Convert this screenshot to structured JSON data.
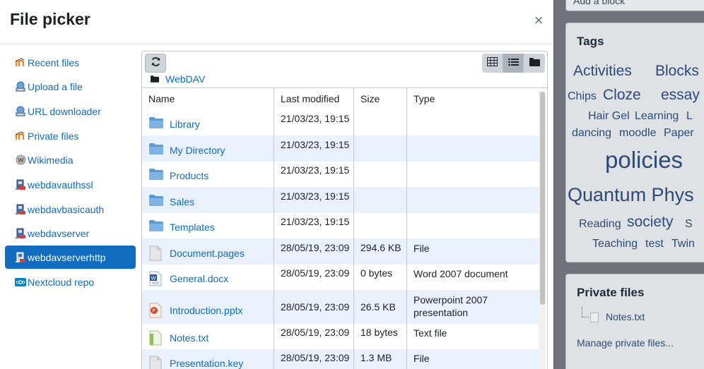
{
  "modal": {
    "title": "File picker",
    "close_symbol": "×"
  },
  "repositories": [
    {
      "label": "Recent files",
      "icon": "moodle-icon",
      "active": false
    },
    {
      "label": "Upload a file",
      "icon": "upload-icon",
      "active": false
    },
    {
      "label": "URL downloader",
      "icon": "url-downloader-icon",
      "active": false
    },
    {
      "label": "Private files",
      "icon": "moodle-icon",
      "active": false
    },
    {
      "label": "Wikimedia",
      "icon": "wikimedia-icon",
      "active": false
    },
    {
      "label": "webdavauthssl",
      "icon": "webdav-icon",
      "active": false
    },
    {
      "label": "webdavbasicauth",
      "icon": "webdav-icon",
      "active": false
    },
    {
      "label": "webdavserver",
      "icon": "webdav-icon",
      "active": false
    },
    {
      "label": "webdavserverhttp",
      "icon": "webdav-icon",
      "active": true
    },
    {
      "label": "Nextcloud repo",
      "icon": "nextcloud-icon",
      "active": false
    }
  ],
  "toolbar": {
    "refresh_icon": "refresh-icon",
    "views": [
      {
        "name": "icons",
        "icon": "grid-icon",
        "active": false
      },
      {
        "name": "list",
        "icon": "list-icon",
        "active": true
      },
      {
        "name": "tree",
        "icon": "folder-icon",
        "active": false
      }
    ]
  },
  "path": {
    "label": "WebDAV"
  },
  "table": {
    "headers": [
      "Name",
      "Last modified",
      "Size",
      "Type"
    ],
    "rows": [
      {
        "name": "Library",
        "modified": "21/03/23, 19:15",
        "size": "",
        "type": "",
        "type2": "",
        "kind": "folder"
      },
      {
        "name": "My Directory",
        "modified": "21/03/23, 19:15",
        "size": "",
        "type": "",
        "type2": "",
        "kind": "folder"
      },
      {
        "name": "Products",
        "modified": "21/03/23, 19:15",
        "size": "",
        "type": "",
        "type2": "",
        "kind": "folder"
      },
      {
        "name": "Sales",
        "modified": "21/03/23, 19:15",
        "size": "",
        "type": "",
        "type2": "",
        "kind": "folder"
      },
      {
        "name": "Templates",
        "modified": "21/03/23, 19:15",
        "size": "",
        "type": "",
        "type2": "",
        "kind": "folder"
      },
      {
        "name": "Document.pages",
        "modified": "28/05/19, 23:09",
        "size": "294.6 KB",
        "type": "File",
        "type2": "",
        "kind": "generic"
      },
      {
        "name": "General.docx",
        "modified": "28/05/19, 23:09",
        "size": "0 bytes",
        "type": "Word 2007 document",
        "type2": "",
        "kind": "word"
      },
      {
        "name": "Introduction.pptx",
        "modified": "28/05/19, 23:09",
        "size": "26.5 KB",
        "type": "Powerpoint 2007",
        "type2": "presentation",
        "kind": "ppt"
      },
      {
        "name": "Notes.txt",
        "modified": "28/05/19, 23:09",
        "size": "18 bytes",
        "type": "Text file",
        "type2": "",
        "kind": "text"
      },
      {
        "name": "Presentation.key",
        "modified": "28/05/19, 23:09",
        "size": "1.3 MB",
        "type": "File",
        "type2": "",
        "kind": "generic"
      }
    ]
  },
  "background": {
    "top_button": "Add a block",
    "tags_title": "Tags",
    "tags": [
      "Activities",
      "Blocks",
      "Chips",
      "Cloze",
      "essay",
      "Hair Gel",
      "Learning",
      "L",
      "dancing",
      "moodle",
      "Paper",
      "policies",
      "Quantum Phys",
      "Reading",
      "society",
      "S",
      "Teaching",
      "test",
      "Twin"
    ],
    "private_files_title": "Private files",
    "private_file": "Notes.txt",
    "manage_link": "Manage private files..."
  },
  "colors": {
    "accent": "#0f6cbf",
    "row_alt": "#e8f1fc",
    "overlay": "#6f7379"
  }
}
